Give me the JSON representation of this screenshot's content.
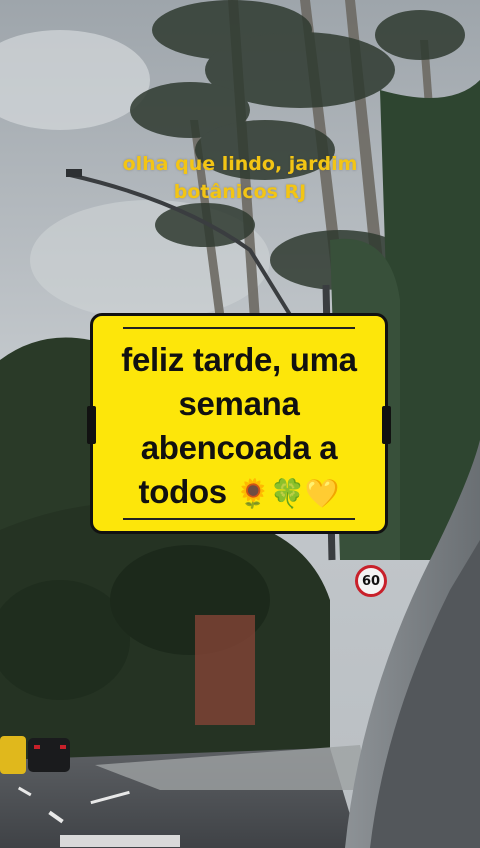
{
  "overlay": {
    "caption_line1": "olha que lindo, jardim",
    "caption_line2": "botânicos RJ",
    "message_line1": "feliz tarde, uma",
    "message_line2": "semana",
    "message_line3": "abencoada a",
    "message_line4": "todos",
    "emojis": "🌻🍀💛"
  },
  "scene": {
    "speed_sign": "60"
  },
  "colors": {
    "caption": "#f3c514",
    "card_background": "#fde60a",
    "card_border": "#111111",
    "sign_ring": "#c8202a"
  }
}
